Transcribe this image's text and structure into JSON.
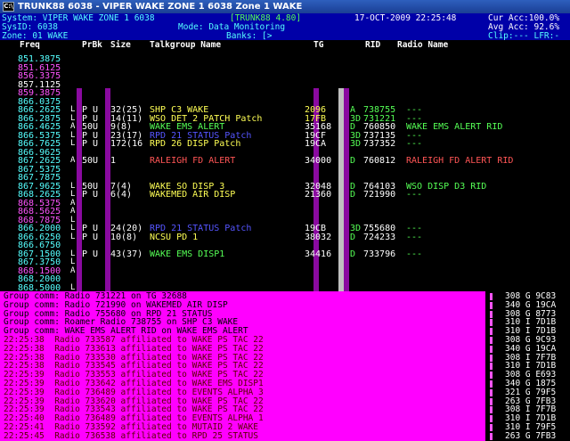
{
  "window": {
    "title": "TRUNK88  6038 - VIPER WAKE ZONE 1 6038   Zone 1 WAKE",
    "icon": "C:\\"
  },
  "status": {
    "system": "System: VIPER WAKE ZONE 1 6038",
    "version": "[TRUNK88 4.80]",
    "datetime": "17-OCT-2009 22:25:48",
    "cur_acc": "Cur Acc:100.0%",
    "sysid": "SysID: 6038",
    "mode": "Mode: Data Monitoring",
    "avg_acc": "Avg Acc: 92.6%",
    "zone": "Zone: 01 WAKE",
    "banks": "Banks: [>",
    "clip": "Clip:--- LFR:-"
  },
  "headers": {
    "freq": "Freq",
    "prbk": "PrBk",
    "size": "Size",
    "tg_name": "Talkgroup Name",
    "tg": "TG",
    "rid": "RID",
    "radio_name": "Radio Name"
  },
  "freqs": [
    {
      "f": "851.3875",
      "c": "cyan"
    },
    {
      "f": "851.6125",
      "c": "mag"
    },
    {
      "f": "856.3375",
      "c": "mag"
    },
    {
      "f": "857.1125",
      "c": "white"
    },
    {
      "f": "859.3875",
      "c": "mag"
    },
    {
      "f": "866.0375",
      "c": "cyan"
    },
    {
      "f": "866.2625",
      "c": "cyan"
    },
    {
      "f": "866.2875",
      "c": "cyan"
    },
    {
      "f": "866.4625",
      "c": "cyan"
    },
    {
      "f": "866.5375",
      "c": "cyan"
    },
    {
      "f": "866.7625",
      "c": "cyan"
    },
    {
      "f": "866.9625",
      "c": "cyan"
    },
    {
      "f": "867.2625",
      "c": "cyan"
    },
    {
      "f": "867.5375",
      "c": "cyan"
    },
    {
      "f": "867.7875",
      "c": "cyan"
    },
    {
      "f": "867.9625",
      "c": "cyan"
    },
    {
      "f": "868.2625",
      "c": "cyan"
    },
    {
      "f": "868.5375",
      "c": "mag"
    },
    {
      "f": "868.5625",
      "c": "mag"
    },
    {
      "f": "868.7875",
      "c": "mag"
    },
    {
      "f": "866.2000",
      "c": "cyan"
    },
    {
      "f": "866.6250",
      "c": "cyan"
    },
    {
      "f": "866.6750",
      "c": "cyan"
    },
    {
      "f": "867.1500",
      "c": "cyan"
    },
    {
      "f": "867.3750",
      "c": "cyan"
    },
    {
      "f": "868.1500",
      "c": "mag"
    },
    {
      "f": "868.2000",
      "c": "cyan"
    },
    {
      "f": "868.5000",
      "c": "cyan"
    }
  ],
  "flags": [
    {
      "row": 6,
      "t": "L"
    },
    {
      "row": 7,
      "t": "L"
    },
    {
      "row": 8,
      "t": "A"
    },
    {
      "row": 9,
      "t": "L"
    },
    {
      "row": 10,
      "t": "L"
    },
    {
      "row": 12,
      "t": "A"
    },
    {
      "row": 15,
      "t": "L"
    },
    {
      "row": 16,
      "t": "L"
    },
    {
      "row": 17,
      "t": "A"
    },
    {
      "row": 18,
      "t": "A"
    },
    {
      "row": 19,
      "t": "L"
    },
    {
      "row": 20,
      "t": "L"
    },
    {
      "row": 21,
      "t": "L"
    },
    {
      "row": 23,
      "t": "L"
    },
    {
      "row": 24,
      "t": "L"
    },
    {
      "row": 25,
      "t": "A"
    },
    {
      "row": 27,
      "t": "L"
    }
  ],
  "calls": [
    {
      "row": 6,
      "prbk": "P U",
      "size": "32(25)",
      "name": "SHP C3 WAKE",
      "tg": "2096",
      "ty": "A",
      "rid": "738755",
      "rname": "---",
      "c": "ylw",
      "tgc": "ylw",
      "ridc": "grn",
      "rnc": "grn"
    },
    {
      "row": 7,
      "prbk": "P U",
      "size": "14(11)",
      "name": "WSO DET 2 PATCH Patch",
      "tg": "17FB",
      "ty": "3D",
      "rid": "731221",
      "rname": "---",
      "c": "ylw",
      "tgc": "ylw",
      "ridc": "grn",
      "rnc": "grn"
    },
    {
      "row": 8,
      "prbk": "50U",
      "size": "9(8)",
      "name": "WAKE EMS ALERT",
      "tg": "35168",
      "ty": "D",
      "rid": "760850",
      "rname": "WAKE EMS ALERT RID",
      "c": "grn",
      "tgc": "white",
      "ridc": "white",
      "rnc": "grn"
    },
    {
      "row": 9,
      "prbk": "P U",
      "size": "23(17)",
      "name": "RPD 21 STATUS Patch",
      "tg": "19CF",
      "ty": "3D",
      "rid": "737135",
      "rname": "---",
      "c": "blu",
      "tgc": "white",
      "ridc": "white",
      "rnc": "grn"
    },
    {
      "row": 10,
      "prbk": "P U",
      "size": "172(16",
      "name": "RPD 26 DISP Patch",
      "tg": "19CA",
      "ty": "3D",
      "rid": "737352",
      "rname": "---",
      "c": "ylw",
      "tgc": "white",
      "ridc": "white",
      "rnc": "grn"
    },
    {
      "row": 12,
      "prbk": "50U",
      "size": "1",
      "name": "RALEIGH FD ALERT",
      "tg": "34000",
      "ty": "D",
      "rid": "760812",
      "rname": "RALEIGH FD ALERT RID",
      "c": "red",
      "tgc": "white",
      "ridc": "white",
      "rnc": "red"
    },
    {
      "row": 15,
      "prbk": "50U",
      "size": "7(4)",
      "name": "WAKE SO DISP 3",
      "tg": "32048",
      "ty": "D",
      "rid": "764103",
      "rname": "WSO DISP D3 RID",
      "c": "ylw",
      "tgc": "white",
      "ridc": "white",
      "rnc": "grn"
    },
    {
      "row": 16,
      "prbk": "P U",
      "size": "6(4)",
      "name": "WAKEMED AIR DISP",
      "tg": "21360",
      "ty": "D",
      "rid": "721990",
      "rname": "---",
      "c": "ylw",
      "tgc": "white",
      "ridc": "white",
      "rnc": "grn"
    },
    {
      "row": 20,
      "prbk": "P U",
      "size": "24(20)",
      "name": "RPD 21 STATUS Patch",
      "tg": "19CB",
      "ty": "3D",
      "rid": "755680",
      "rname": "---",
      "c": "blu",
      "tgc": "white",
      "ridc": "white",
      "rnc": "grn"
    },
    {
      "row": 21,
      "prbk": "P U",
      "size": "10(8)",
      "name": "NCSU PD 1",
      "tg": "38032",
      "ty": "D",
      "rid": "724233",
      "rname": "---",
      "c": "ylw",
      "tgc": "white",
      "ridc": "white",
      "rnc": "grn"
    },
    {
      "row": 23,
      "prbk": "P U",
      "size": "43(37)",
      "name": "WAKE EMS DISP1",
      "tg": "34416",
      "ty": "D",
      "rid": "733796",
      "rname": "---",
      "c": "grn",
      "tgc": "white",
      "ridc": "white",
      "rnc": "grn"
    }
  ],
  "activity": [
    {
      "t": "Group comm: Radio 731221 on TG 32688",
      "c": "plain"
    },
    {
      "t": "Group comm: Radio 721990 on WAKEMED AIR DISP",
      "c": "plain"
    },
    {
      "t": "Group comm: Radio 755680 on RPD 21 STATUS",
      "c": "plain"
    },
    {
      "t": "Group comm: Roamer Radio 738755 on SHP C3 WAKE",
      "c": "plain"
    },
    {
      "t": "Group comm: WAKE EMS ALERT RID on WAKE EMS ALERT",
      "c": "plain"
    },
    {
      "t": "22:25:38  Radio 733587 affiliated to WAKE PS TAC 22",
      "c": "red"
    },
    {
      "t": "22:25:38  Radio 733613 affiliated to WAKE PS TAC 22",
      "c": "red"
    },
    {
      "t": "22:25:38  Radio 733530 affiliated to WAKE PS TAC 22",
      "c": "red"
    },
    {
      "t": "22:25:38  Radio 733545 affiliated to WAKE PS TAC 22",
      "c": "red"
    },
    {
      "t": "22:25:39  Radio 733553 affiliated to WAKE PS TAC 22",
      "c": "red"
    },
    {
      "t": "22:25:39  Radio 733642 affiliated to WAKE EMS DISP1",
      "c": "red"
    },
    {
      "t": "22:25:39  Radio 736489 affiliated to EVENTS ALPHA 3",
      "c": "red"
    },
    {
      "t": "22:25:39  Radio 733620 affiliated to WAKE PS TAC 22",
      "c": "red"
    },
    {
      "t": "22:25:39  Radio 733543 affiliated to WAKE PS TAC 22",
      "c": "red"
    },
    {
      "t": "22:25:40  Radio 736489 affiliated to EVENTS ALPHA 1",
      "c": "red"
    },
    {
      "t": "22:25:41  Radio 733592 affiliated to MUTAID 2 WAKE",
      "c": "red"
    },
    {
      "t": "22:25:45  Radio 736538 affiliated to RPD 25 STATUS",
      "c": "red"
    }
  ],
  "side": [
    "308 G 9C83",
    "340 G 19CA",
    "308 G 8773",
    "310 I 7D1B",
    "310 I 7D1B",
    "308 G 9C93",
    "340 G 19CA",
    "308 I 7F7B",
    "310 I 7D1B",
    "308 G E693",
    "340 G 1875",
    "321 G 79F5",
    "263 G 7FB3",
    "308 I 7F7B",
    "310 I 7D1B",
    "310 I 79F5",
    "263 G 7FB3"
  ]
}
